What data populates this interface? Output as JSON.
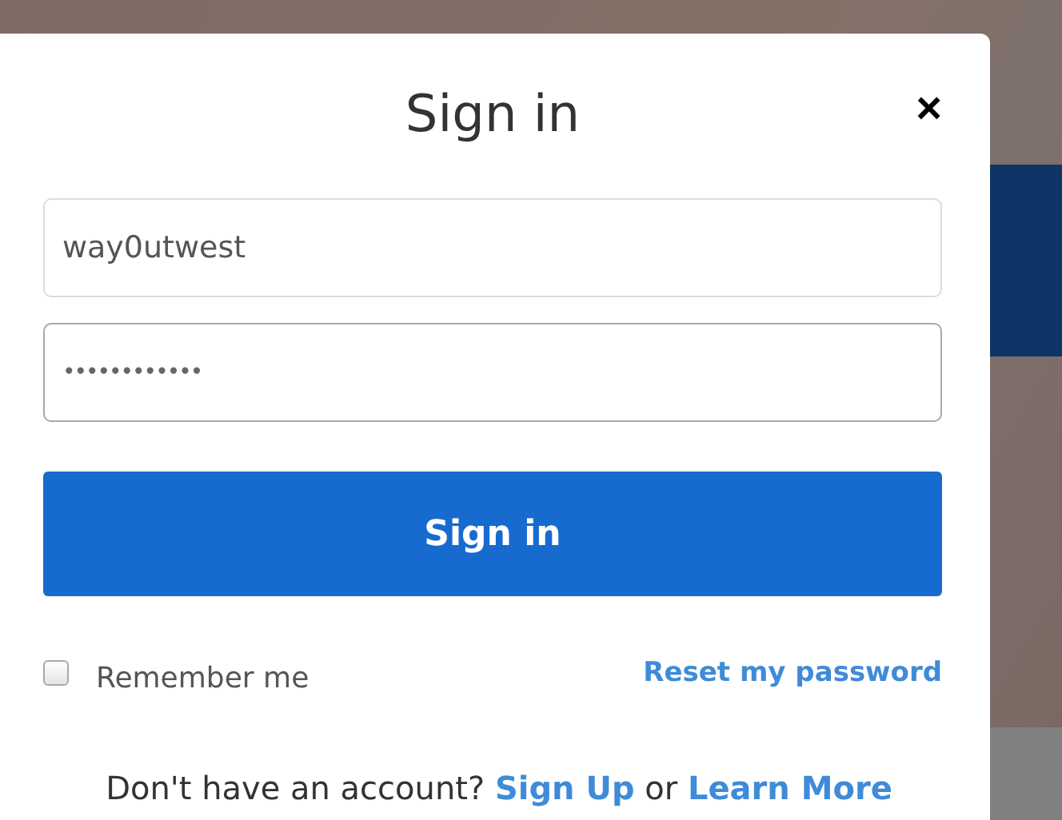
{
  "dialog": {
    "title": "Sign in",
    "close": "×"
  },
  "fields": [
    {
      "kind": "text",
      "value": "way0utwest",
      "focused": false
    },
    {
      "kind": "password",
      "value": "••••••••••••",
      "focused": true
    }
  ],
  "submit": "Sign in",
  "remember": {
    "label": "Remember me",
    "checked": false
  },
  "reset_link": "Reset my password",
  "footer": {
    "prompt": "Don't have an account?",
    "signup": "Sign Up",
    "joiner": "or",
    "learn_more": "Learn More"
  }
}
